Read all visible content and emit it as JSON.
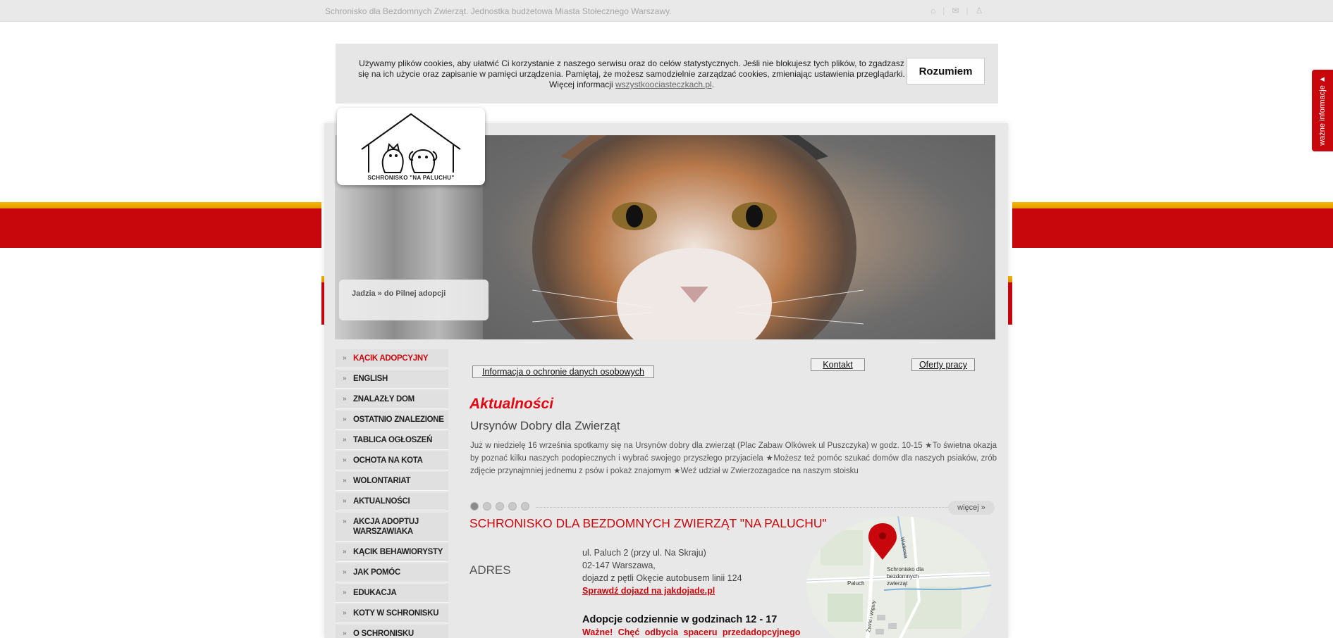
{
  "topbar": {
    "tagline": "Schronisko dla Bezdomnych Zwierząt. Jednostka budżetowa Miasta Stołecznego Warszawy.",
    "icons": [
      "home-icon",
      "mail-icon",
      "sitemap-icon"
    ]
  },
  "cookie": {
    "text": "Używamy plików cookies, aby ułatwić Ci korzystanie z naszego serwisu oraz do celów statystycznych. Jeśli nie blokujesz tych plików, to zgadzasz się na ich użycie oraz zapisanie w pamięci urządzenia. Pamiętaj, że możesz samodzielnie zarządzać cookies, zmieniając ustawienia przeglądarki. Więcej informacji ",
    "link": "wszystkoociasteczkach.pl",
    "after_link": ".",
    "button": "Rozumiem"
  },
  "sidetab": {
    "label": "ważne informacje ▲"
  },
  "logo": {
    "text": "SCHRONISKO \"NA PALUCHU\""
  },
  "hero": {
    "caption": "Jadzia » do Pilnej adopcji"
  },
  "menu": {
    "items": [
      {
        "label": "KĄCIK ADOPCYJNY",
        "active": true
      },
      {
        "label": "ENGLISH"
      },
      {
        "label": "ZNALAZŁY DOM"
      },
      {
        "label": "OSTATNIO ZNALEZIONE"
      },
      {
        "label": "TABLICA OGŁOSZEŃ"
      },
      {
        "label": "OCHOTA NA KOTA"
      },
      {
        "label": "WOLONTARIAT"
      },
      {
        "label": "AKTUALNOŚCI"
      },
      {
        "label": "AKCJA ADOPTUJ WARSZAWIAKA"
      },
      {
        "label": "KĄCIK BEHAWIORYSTY"
      },
      {
        "label": "JAK POMÓC"
      },
      {
        "label": "EDUKACJA"
      },
      {
        "label": "KOTY W SCHRONISKU"
      },
      {
        "label": "O SCHRONISKU"
      }
    ]
  },
  "buttons": {
    "privacy": "Informacja o ochronie danych osobowych",
    "contact": "Kontakt",
    "jobs": "Oferty pracy"
  },
  "news": {
    "heading": "Aktualności",
    "title": "Ursynów Dobry dla Zwierząt",
    "body": "Już w niedzielę 16 września spotkamy się na Ursynów dobry dla zwierząt (Plac Zabaw Olkówek ul Puszczyka) w godz. 10-15 ★To świetna okazja by poznać kilku naszych podopiecznych i wybrać swojego przyszłego przyjaciela ★Możesz też pomóc szukać domów dla naszych psiaków, zrób zdjęcie przynajmniej jednemu z psów i pokaż znajomym ★Weź udział w Zwierzozagadce na naszym stoisku",
    "slides": 5,
    "active_slide": 1,
    "more": "więcej »"
  },
  "shelter": {
    "title": "SCHRONISKO DLA BEZDOMNYCH ZWIERZĄT \"NA PALUCHU\"",
    "address_label": "ADRES",
    "address_line1": "ul. Paluch 2 (przy ul. Na Skraju)",
    "address_line2": "02-147 Warszawa,",
    "address_line3": "dojazd z pętli Okęcie autobusem linii 124",
    "route_link": "Sprawdź dojazd na jakdojade.pl",
    "hours": "Adopcje codziennie w godzinach 12 - 17",
    "important": "Ważne! Chęć odbycia spaceru przedadopcyjnego"
  },
  "map": {
    "pin_label_1": "Schronisko dla",
    "pin_label_2": "bezdomnych",
    "pin_label_3": "zwierząt",
    "street_1": "Paluch",
    "street_2": "Wiatkowa",
    "street_3": "Żwirki i Wigury"
  },
  "colors": {
    "brand_red": "#c8070d",
    "gold": "#f7b700",
    "news_red": "#e20613"
  }
}
